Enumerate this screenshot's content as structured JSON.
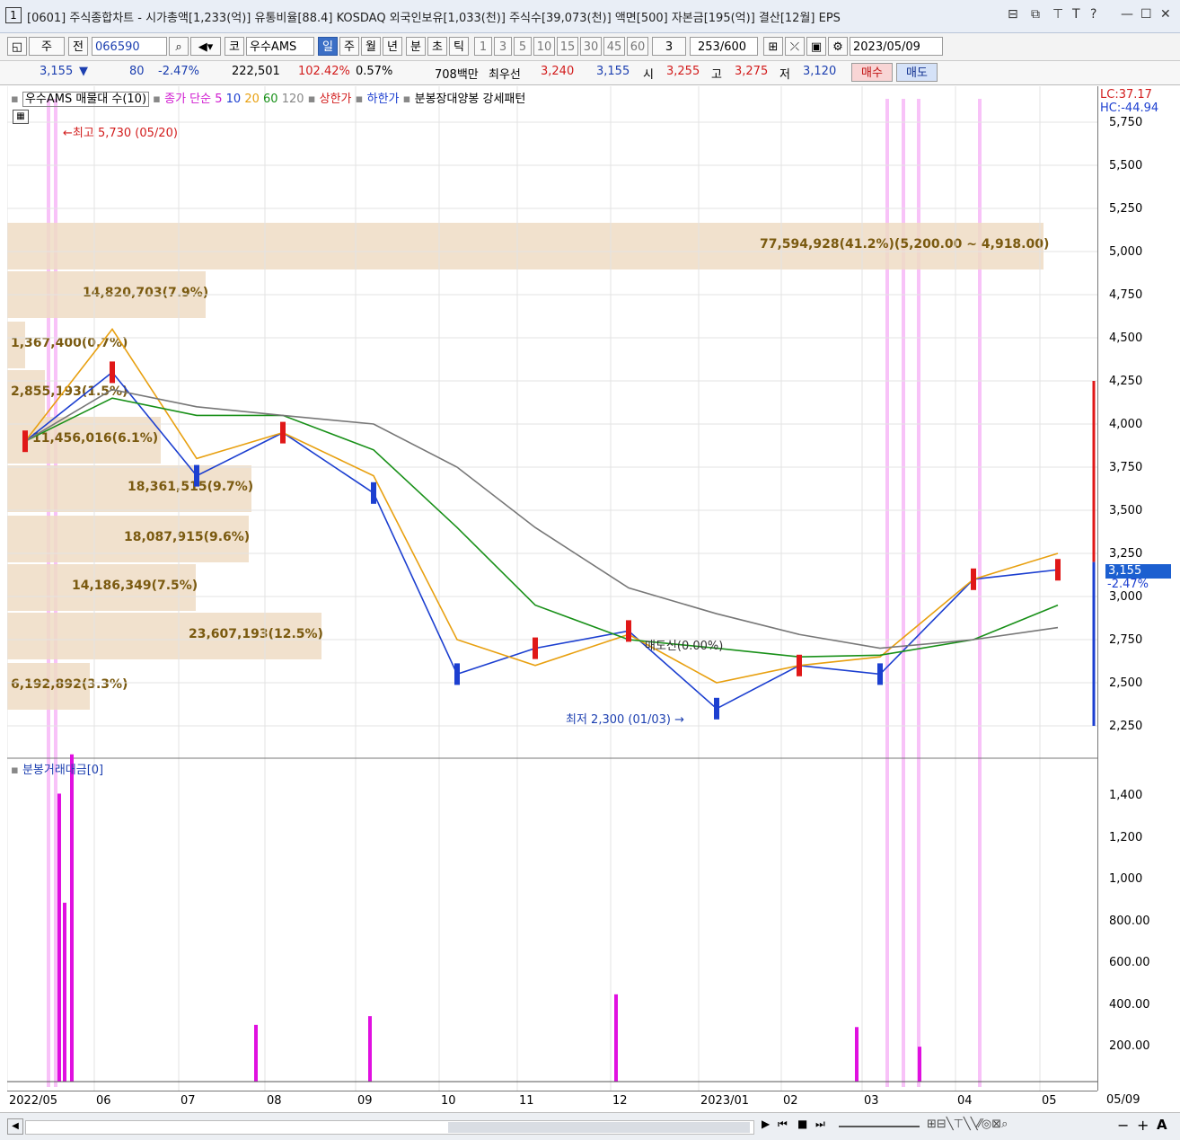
{
  "titlebar": {
    "window_num": "1",
    "title": "[0601] 주식종합차트 - 시가총액[1,233(억)] 유통비율[88.4] KOSDAQ 외국인보유[1,033(천)] 주식수[39,073(천)] 액면[500] 자본금[195(억)] 결산[12월] EPS",
    "buttons": [
      "⊟",
      "⧉",
      "⊤",
      "T",
      "?",
      "—",
      "☐",
      "✕"
    ]
  },
  "toolbar": {
    "type_select": "주",
    "prev_label": "전",
    "code": "066590",
    "market": "코",
    "stock_name": "우수AMS",
    "periods": [
      "일",
      "주",
      "월",
      "년",
      "분",
      "초",
      "틱"
    ],
    "intervals": [
      "1",
      "3",
      "5",
      "10",
      "15",
      "30",
      "45",
      "60"
    ],
    "count_value": "3",
    "bar_count": "253",
    "bar_total": "/600",
    "date": "2023/05/09"
  },
  "quote": {
    "price": "3,155",
    "change_arrow": "▼",
    "change": "80",
    "change_pct": "-2.47%",
    "volume": "222,501",
    "vol_ratio": "102.42%",
    "turnover": "0.57%",
    "amount": "708백만",
    "best_bid_label": "최우선",
    "best_ask": "3,240",
    "best_bid": "3,155",
    "open_label": "시",
    "open": "3,255",
    "high_label": "고",
    "high": "3,275",
    "low_label": "저",
    "low": "3,120",
    "buy_label": "매수",
    "sell_label": "매도"
  },
  "legend": {
    "stock": "우수AMS 매물대 수(10)",
    "ma_label": "종가 단순 5",
    "ma10": "10",
    "ma20": "20",
    "ma60": "60",
    "ma120": "120",
    "upper_limit": "상한가",
    "lower_limit": "하한가",
    "pattern": "분봉장대양봉 강세패턴",
    "lc": "LC:37.17",
    "hc": "HC:-44.94"
  },
  "annotations": {
    "high": "최고 5,730 (05/20)",
    "low": "최저 2,300 (01/03)",
    "sell_signal": "매도신(0.00%)"
  },
  "price_axis": [
    "5,750",
    "5,500",
    "5,250",
    "5,000",
    "4,750",
    "4,500",
    "4,250",
    "4,000",
    "3,750",
    "3,500",
    "3,250",
    "3,000",
    "2,750",
    "2,500",
    "2,250"
  ],
  "current_price_tag": "3,155",
  "current_change_tag": "-2.47%",
  "volume_profile": [
    {
      "label": "77,594,928(41.2%)(5,200.00 ~ 4,918.00)",
      "pct": 41.2
    },
    {
      "label": "14,820,703(7.9%)",
      "pct": 7.9
    },
    {
      "label": "1,367,400(0.7%)",
      "pct": 0.7
    },
    {
      "label": "2,855,193(1.5%)",
      "pct": 1.5
    },
    {
      "label": "11,456,016(6.1%)",
      "pct": 6.1
    },
    {
      "label": "18,361,515(9.7%)",
      "pct": 9.7
    },
    {
      "label": "18,087,915(9.6%)",
      "pct": 9.6
    },
    {
      "label": "14,186,349(7.5%)",
      "pct": 7.5
    },
    {
      "label": "23,607,193(12.5%)",
      "pct": 12.5
    },
    {
      "label": "6,192,892(3.3%)",
      "pct": 3.3
    }
  ],
  "volume_panel": {
    "title": "분봉거래대금[0]",
    "axis": [
      "1,400",
      "1,200",
      "1,000",
      "800.00",
      "600.00",
      "400.00",
      "200.00"
    ]
  },
  "x_axis": [
    "2022/05",
    "06",
    "07",
    "08",
    "09",
    "10",
    "11",
    "12",
    "2023/01",
    "02",
    "03",
    "04",
    "05"
  ],
  "x_axis_right": "05/09",
  "chart_data": {
    "type": "line",
    "title": "",
    "ylim": [
      2250,
      5750
    ],
    "x": [
      "2022/05",
      "2022/06",
      "2022/07",
      "2022/08",
      "2022/09",
      "2022/10",
      "2022/11",
      "2022/12",
      "2023/01",
      "2023/02",
      "2023/03",
      "2023/04",
      "2023/05"
    ],
    "series": [
      {
        "name": "close",
        "values": [
          3900,
          4300,
          3700,
          3950,
          3600,
          2550,
          2700,
          2800,
          2350,
          2600,
          2550,
          3100,
          3155
        ]
      },
      {
        "name": "20",
        "values": [
          3900,
          4550,
          3800,
          3950,
          3700,
          2750,
          2600,
          2780,
          2500,
          2600,
          2650,
          3100,
          3250
        ]
      },
      {
        "name": "60",
        "values": [
          3900,
          4150,
          4050,
          4050,
          3850,
          3400,
          2950,
          2750,
          2700,
          2650,
          2660,
          2750,
          2950
        ]
      },
      {
        "name": "120",
        "values": [
          3900,
          4200,
          4100,
          4050,
          4000,
          3750,
          3400,
          3050,
          2900,
          2780,
          2700,
          2750,
          2820
        ]
      }
    ],
    "volume_highlights": [
      1320,
      820,
      1500,
      260,
      300,
      400,
      250,
      160
    ]
  },
  "bottombar": {
    "nav": [
      "▶",
      "⏮",
      "■",
      "⏭"
    ],
    "zoom_minus": "−",
    "zoom_plus": "+",
    "font_btn": "A"
  }
}
